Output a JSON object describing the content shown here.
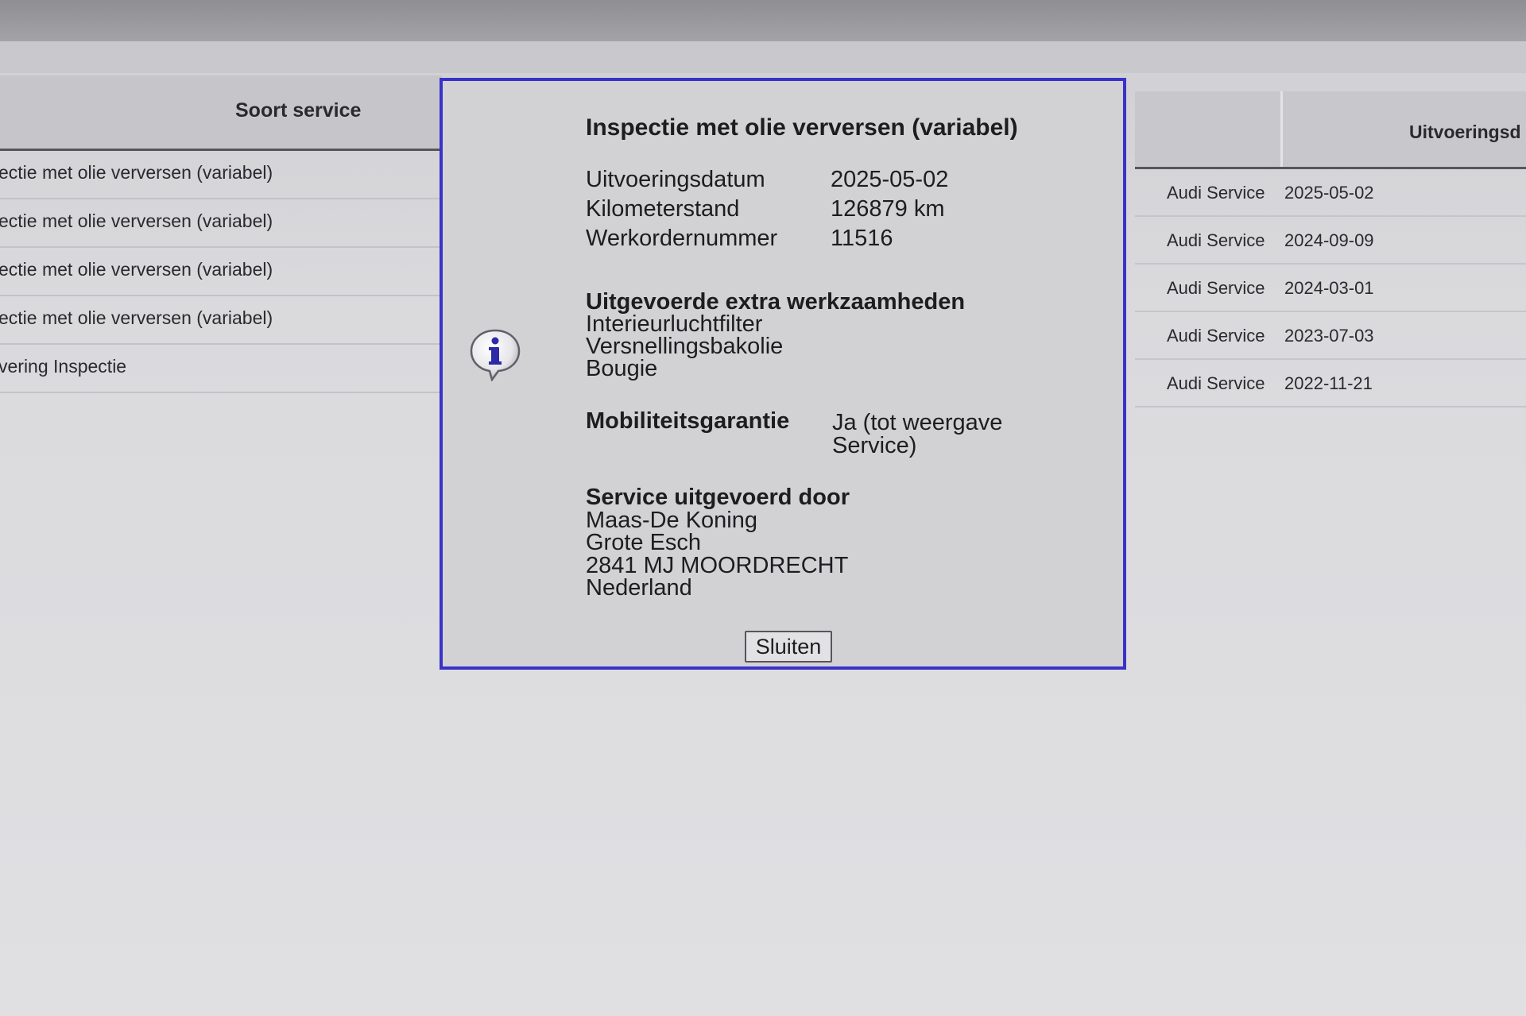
{
  "left_table": {
    "header": "Soort service",
    "rows": [
      "ectie met olie verversen (variabel)",
      "ectie met olie verversen (variabel)",
      "ectie met olie verversen (variabel)",
      "ectie met olie verversen (variabel)",
      "vering Inspectie"
    ]
  },
  "right_table": {
    "header": "Uitvoeringsd",
    "rows": [
      {
        "type": "Audi Service",
        "date": "2025-05-02"
      },
      {
        "type": "Audi Service",
        "date": "2024-09-09"
      },
      {
        "type": "Audi Service",
        "date": "2024-03-01"
      },
      {
        "type": "Audi Service",
        "date": "2023-07-03"
      },
      {
        "type": "Audi Service",
        "date": "2022-11-21"
      }
    ]
  },
  "dialog": {
    "title": "Inspectie met olie verversen (variabel)",
    "icon": "info-speech-bubble-icon",
    "details": [
      {
        "label": "Uitvoeringsdatum",
        "value": "2025-05-02"
      },
      {
        "label": "Kilometerstand",
        "value": "126879 km"
      },
      {
        "label": "Werkordernummer",
        "value": "11516"
      }
    ],
    "extra_title": "Uitgevoerde extra werkzaamheden",
    "extra_items": [
      "Interieurluchtfilter",
      "Versnellingsbakolie",
      "Bougie"
    ],
    "mobility_label": "Mobiliteitsgarantie",
    "mobility_value_line1": "Ja (tot weergave",
    "mobility_value_line2": "Service)",
    "performed_by_title": "Service uitgevoerd door",
    "performed_by": [
      "Maas-De Koning",
      "Grote Esch",
      "2841 MJ MOORDRECHT",
      "Nederland"
    ],
    "close_label": "Sluiten",
    "border_color": "#3a32c8"
  }
}
